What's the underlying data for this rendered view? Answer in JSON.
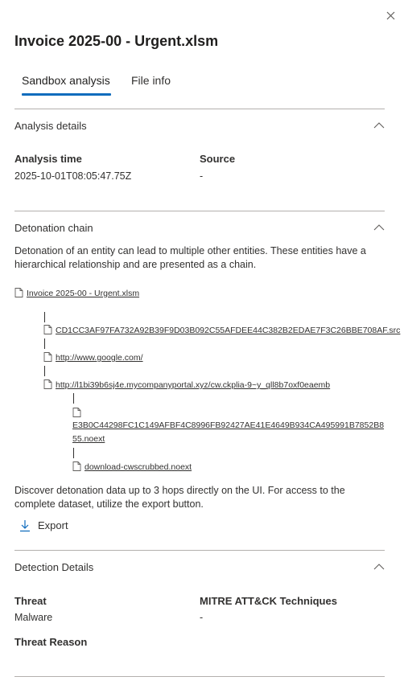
{
  "panel": {
    "title": "Invoice 2025-00 - Urgent.xlsm",
    "close_icon": "close-icon"
  },
  "tabs": [
    {
      "label": "Sandbox analysis",
      "selected": true
    },
    {
      "label": "File info",
      "selected": false
    }
  ],
  "colors": {
    "accent": "#0f6cbd",
    "divider": "#b3b0ad",
    "text": "#323130"
  },
  "analysis_details": {
    "title": "Analysis details",
    "analysis_time_label": "Analysis time",
    "analysis_time_value": "2025-10-01T08:05:47.75Z",
    "source_label": "Source",
    "source_value": "-"
  },
  "detonation_chain": {
    "title": "Detonation chain",
    "description": "Detonation of an entity can lead to multiple other entities. These entities have a hierarchical relationship and are presented as a chain.",
    "root": "Invoice 2025-00 - Urgent.xlsm",
    "children": [
      "CD1CC3AF97FA732A92B39F9D03B092C55AFDEE44C382B2EDAE7F3C26BBE708AF.src",
      "http://www.google.com/",
      "http://l1bi39b6sj4e.mycompanyportal.xyz/cw.ckplia-9~y_qll8b7oxf0eaemb"
    ],
    "grandchildren": [
      "E3B0C44298FC1C149AFBF4C8996FB92427AE41E4649B934CA495991B7852B855.noext",
      "download-cwscrubbed.noext"
    ],
    "footer": "Discover detonation data up to 3 hops directly on the UI. For access to the complete dataset, utilize the export button.",
    "export_label": "Export"
  },
  "detection_details": {
    "title": "Detection Details",
    "threat_label": "Threat",
    "threat_value": "Malware",
    "mitre_label": "MITRE ATT&CK Techniques",
    "mitre_value": "-",
    "threat_reason_label": "Threat Reason"
  }
}
